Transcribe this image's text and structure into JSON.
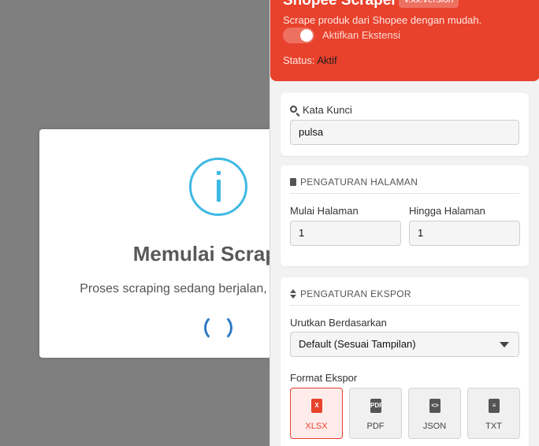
{
  "modal": {
    "title": "Memulai Scraping",
    "text": "Proses scraping sedang berjalan, mohon tunggu...",
    "icon": "info-icon",
    "accent": "#3fb9e3",
    "spinner_color": "#2f7bc4"
  },
  "panel": {
    "app_title": "Shopee Scraper",
    "version": "v.xx.version",
    "subtitle": "Scrape produk dari Shopee dengan mudah.",
    "toggle_label": "Aktifkan Ekstensi",
    "status_label": "Status:",
    "status_value": "Aktif",
    "brand_color": "#e8412c"
  },
  "keyword": {
    "label": "Kata Kunci",
    "value": "pulsa",
    "icon": "search-icon"
  },
  "pages": {
    "heading": "PENGATURAN HALAMAN",
    "icon": "document-icon",
    "start_label": "Mulai Halaman",
    "start_value": "1",
    "end_label": "Hingga Halaman",
    "end_value": "1"
  },
  "export": {
    "heading": "PENGATURAN EKSPOR",
    "icon": "sort-icon",
    "sort_label": "Urutkan Berdasarkan",
    "sort_value": "Default (Sesuai Tampilan)",
    "format_label": "Format Ekspor",
    "formats": [
      {
        "label": "XLSX",
        "icon": "excel-file-icon",
        "glyph": "X"
      },
      {
        "label": "PDF",
        "icon": "pdf-file-icon",
        "glyph": "PDF"
      },
      {
        "label": "JSON",
        "icon": "code-file-icon",
        "glyph": "<>"
      },
      {
        "label": "TXT",
        "icon": "text-file-icon",
        "glyph": "≡"
      }
    ],
    "selected": "XLSX"
  }
}
